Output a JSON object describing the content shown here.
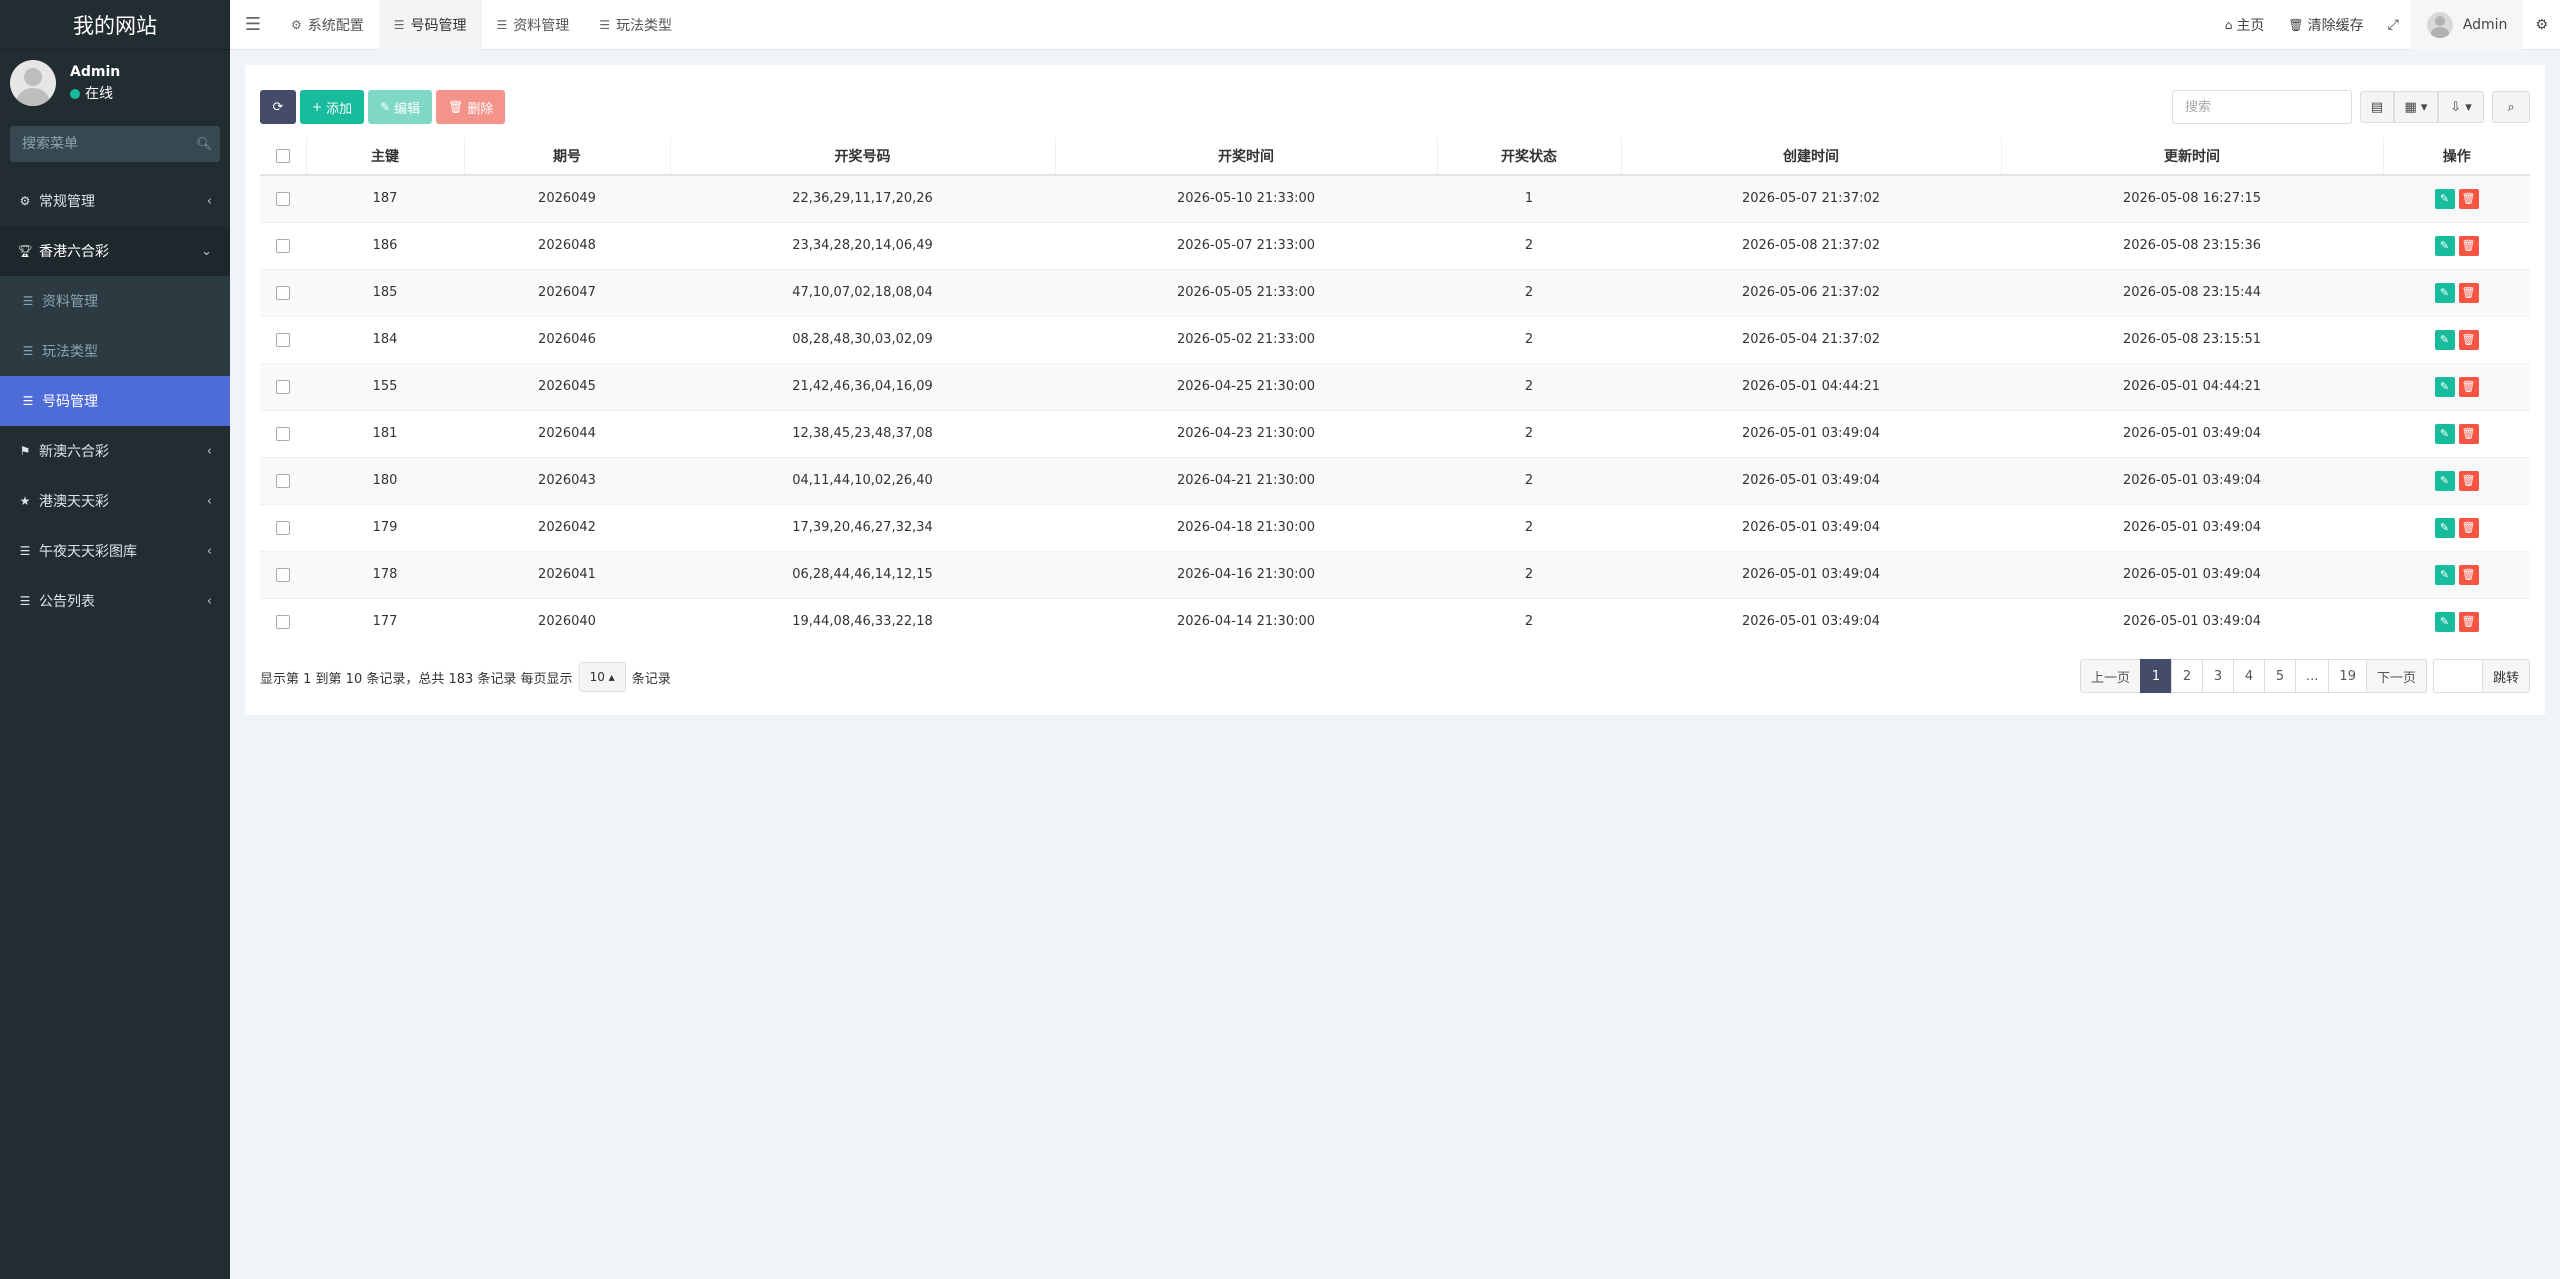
{
  "sidebar": {
    "logo": "我的网站",
    "user": {
      "name": "Admin",
      "status": "在线"
    },
    "search_placeholder": "搜索菜单",
    "menu": [
      {
        "label": "常规管理",
        "icon": "cogs-icon"
      },
      {
        "label": "香港六合彩",
        "icon": "trophy-icon",
        "open": true
      }
    ],
    "submenu": [
      {
        "label": "资料管理"
      },
      {
        "label": "玩法类型"
      },
      {
        "label": "号码管理",
        "active": true
      }
    ],
    "menu_after": [
      {
        "label": "新澳六合彩",
        "icon": "flag-icon"
      },
      {
        "label": "港澳天天彩",
        "icon": "star-icon"
      },
      {
        "label": "午夜天天彩图库",
        "icon": "list-icon"
      },
      {
        "label": "公告列表",
        "icon": "list-icon"
      }
    ]
  },
  "topnav": {
    "tabs": [
      {
        "label": "系统配置"
      },
      {
        "label": "号码管理",
        "active": true
      },
      {
        "label": "资料管理"
      },
      {
        "label": "玩法类型"
      }
    ],
    "home": "主页",
    "clear_cache": "清除缓存",
    "admin": "Admin"
  },
  "toolbar": {
    "add": "添加",
    "edit": "编辑",
    "delete": "删除",
    "search_placeholder": "搜索"
  },
  "table": {
    "headers": [
      "主键",
      "期号",
      "开奖号码",
      "开奖时间",
      "开奖状态",
      "创建时间",
      "更新时间",
      "操作"
    ],
    "rows": [
      [
        "187",
        "2026049",
        "22,36,29,11,17,20,26",
        "2026-05-10 21:33:00",
        "1",
        "2026-05-07 21:37:02",
        "2026-05-08 16:27:15"
      ],
      [
        "186",
        "2026048",
        "23,34,28,20,14,06,49",
        "2026-05-07 21:33:00",
        "2",
        "2026-05-08 21:37:02",
        "2026-05-08 23:15:36"
      ],
      [
        "185",
        "2026047",
        "47,10,07,02,18,08,04",
        "2026-05-05 21:33:00",
        "2",
        "2026-05-06 21:37:02",
        "2026-05-08 23:15:44"
      ],
      [
        "184",
        "2026046",
        "08,28,48,30,03,02,09",
        "2026-05-02 21:33:00",
        "2",
        "2026-05-04 21:37:02",
        "2026-05-08 23:15:51"
      ],
      [
        "155",
        "2026045",
        "21,42,46,36,04,16,09",
        "2026-04-25 21:30:00",
        "2",
        "2026-05-01 04:44:21",
        "2026-05-01 04:44:21"
      ],
      [
        "181",
        "2026044",
        "12,38,45,23,48,37,08",
        "2026-04-23 21:30:00",
        "2",
        "2026-05-01 03:49:04",
        "2026-05-01 03:49:04"
      ],
      [
        "180",
        "2026043",
        "04,11,44,10,02,26,40",
        "2026-04-21 21:30:00",
        "2",
        "2026-05-01 03:49:04",
        "2026-05-01 03:49:04"
      ],
      [
        "179",
        "2026042",
        "17,39,20,46,27,32,34",
        "2026-04-18 21:30:00",
        "2",
        "2026-05-01 03:49:04",
        "2026-05-01 03:49:04"
      ],
      [
        "178",
        "2026041",
        "06,28,44,46,14,12,15",
        "2026-04-16 21:30:00",
        "2",
        "2026-05-01 03:49:04",
        "2026-05-01 03:49:04"
      ],
      [
        "177",
        "2026040",
        "19,44,08,46,33,22,18",
        "2026-04-14 21:30:00",
        "2",
        "2026-05-01 03:49:04",
        "2026-05-01 03:49:04"
      ]
    ]
  },
  "footer": {
    "info_prefix": "显示第 1 到第 10 条记录，总共 183 条记录 每页显示",
    "page_size": "10",
    "info_suffix": "条记录",
    "prev": "上一页",
    "pages": [
      "1",
      "2",
      "3",
      "4",
      "5",
      "...",
      "19"
    ],
    "next": "下一页",
    "jump": "跳转"
  },
  "colors": {
    "sidebar_bg": "#222d32",
    "active_blue": "#4d6cd8",
    "success": "#18bc9c",
    "danger": "#f75444",
    "primary_dark": "#444c69"
  }
}
